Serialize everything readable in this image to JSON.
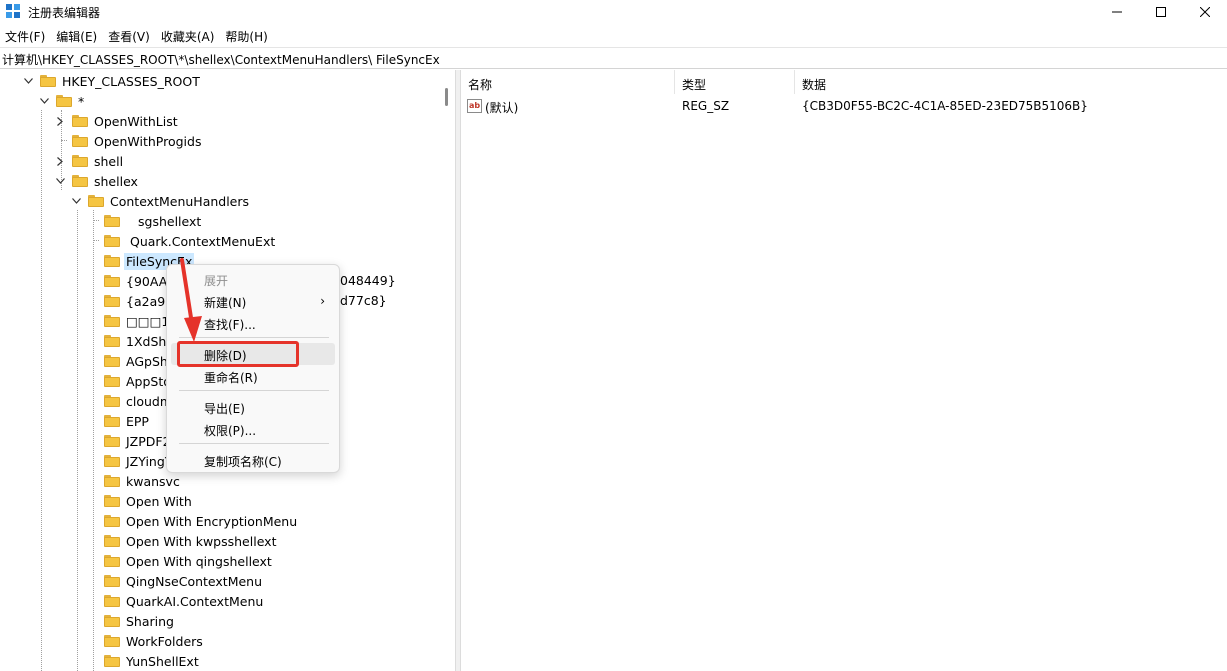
{
  "window": {
    "title": "注册表编辑器",
    "controls": {
      "minimize": "—",
      "maximize": "☐",
      "close": "✕"
    }
  },
  "menubar": [
    "文件(F)",
    "编辑(E)",
    "查看(V)",
    "收藏夹(A)",
    "帮助(H)"
  ],
  "address": "计算机\\HKEY_CLASSES_ROOT\\*\\shellex\\ContextMenuHandlers\\ FileSyncEx",
  "tree": {
    "rows": [
      "HKEY_CLASSES_ROOT",
      "*",
      "OpenWithList",
      "OpenWithProgids",
      "shell",
      "shellex",
      "ContextMenuHandlers",
      "sgshellext",
      "Quark.ContextMenuExt",
      "FileSyncEx",
      "{90AA3A",
      "{a2a954",
      "□□□100",
      "1XdShel",
      "AGpShe",
      "AppStor",
      "cloudmu",
      "EPP",
      "JZPDF2I",
      "JZYingYi",
      "kwansvc",
      "Open With",
      "Open With EncryptionMenu",
      "Open With kwpsshellext",
      "Open With qingshellext",
      "QingNseContextMenu",
      "QuarkAI.ContextMenu",
      "Sharing",
      "WorkFolders",
      "YunShellExt"
    ],
    "overflow_right_a": "048449}",
    "overflow_right_b": "d77c8}"
  },
  "values": {
    "headers": {
      "name": "名称",
      "type": "类型",
      "data": "数据"
    },
    "rows": [
      {
        "icon": "ab",
        "name": "(默认)",
        "type": "REG_SZ",
        "data": "{CB3D0F55-BC2C-4C1A-85ED-23ED75B5106B}"
      }
    ]
  },
  "context_menu": {
    "items": {
      "expand": "展开",
      "new": "新建(N)",
      "find": "查找(F)...",
      "delete": "删除(D)",
      "rename": "重命名(R)",
      "export": "导出(E)",
      "permissions": "权限(P)...",
      "copy_key_name": "复制项名称(C)"
    },
    "submenu_glyph": "›"
  },
  "colors": {
    "annotation_red": "#e5332a",
    "selection": "#cce8ff",
    "folder": "#f5c542"
  }
}
